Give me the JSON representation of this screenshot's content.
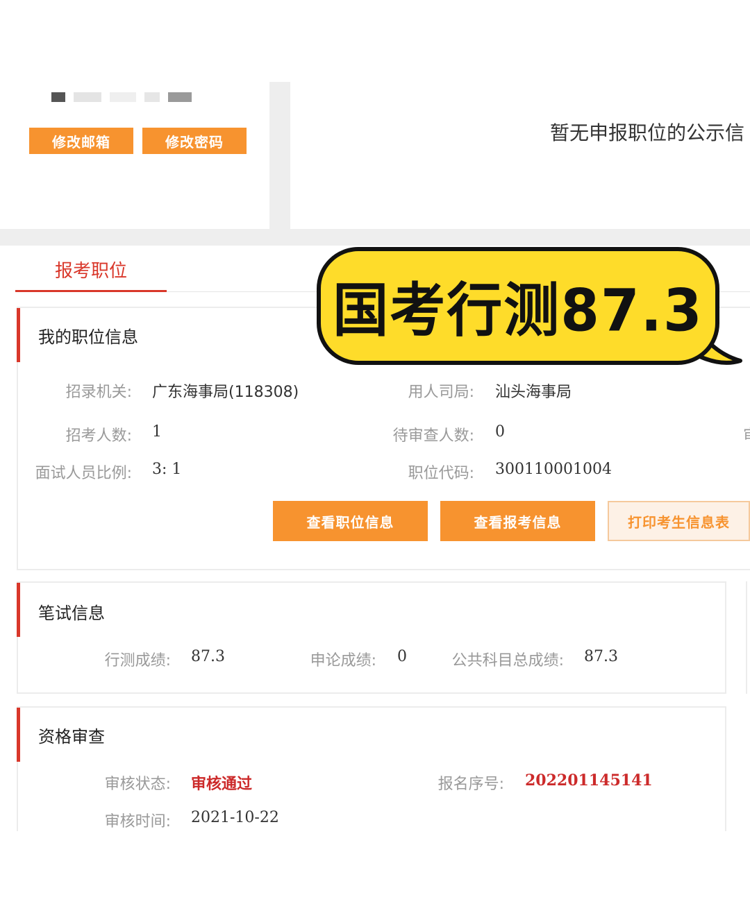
{
  "account": {
    "change_email_label": "修改邮箱",
    "change_password_label": "修改密码"
  },
  "notice": {
    "text": "暂无申报职位的公示信"
  },
  "tabs": {
    "active_label": "报考职位"
  },
  "overlay": {
    "bubble_text": "国考行测87.3",
    "colors": {
      "fill": "#fedc2a",
      "stroke": "#111111"
    }
  },
  "position_info": {
    "title": "我的职位信息",
    "fields": {
      "agency_label": "招录机关:",
      "agency_value": "广东海事局(118308)",
      "employer_label": "用人司局:",
      "employer_value": "汕头海事局",
      "hire_count_label": "招考人数:",
      "hire_count_value": "1",
      "pending_label": "待审查人数:",
      "pending_value": "0",
      "ratio_label": "面试人员比例:",
      "ratio_value": "3: 1",
      "code_label": "职位代码:",
      "code_value": "300110001004",
      "cutoff_label": "审"
    },
    "buttons": {
      "view_position": "查看职位信息",
      "view_application": "查看报考信息",
      "print_info": "打印考生信息表"
    }
  },
  "written_exam": {
    "title": "笔试信息",
    "xingce_label": "行测成绩:",
    "xingce_value": "87.3",
    "shenlun_label": "申论成绩:",
    "shenlun_value": "0",
    "total_label": "公共科目总成绩:",
    "total_value": "87.3"
  },
  "qualification": {
    "title": "资格审查",
    "status_label": "审核状态:",
    "status_value": "审核通过",
    "reg_no_label": "报名序号:",
    "reg_no_value": "202201145141",
    "time_label": "审核时间:",
    "time_value": "2021-10-22"
  },
  "theme": {
    "accent_orange": "#f7932f",
    "accent_red": "#d9372a"
  }
}
